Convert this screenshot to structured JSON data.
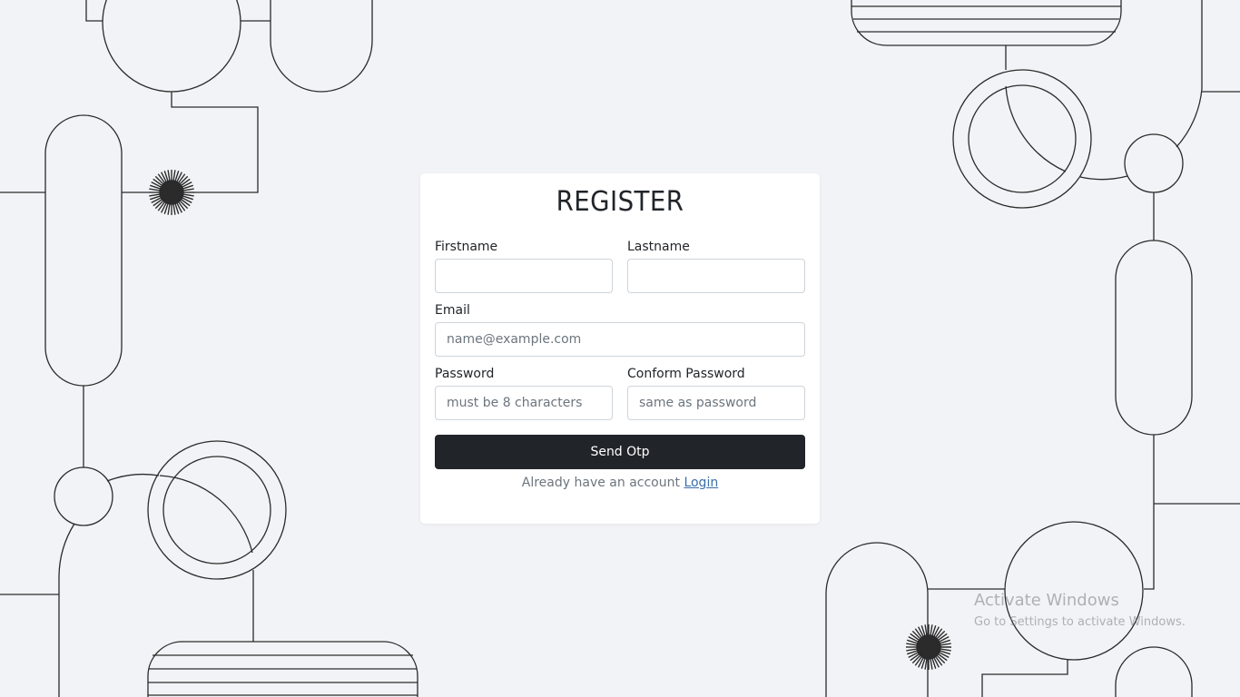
{
  "form": {
    "title": "REGISTER",
    "firstname_label": "Firstname",
    "firstname_value": "",
    "lastname_label": "Lastname",
    "lastname_value": "",
    "email_label": "Email",
    "email_placeholder": "name@example.com",
    "password_label": "Password",
    "password_placeholder": "must be 8 characters",
    "confirm_label": "Conform Password",
    "confirm_placeholder": "same as password",
    "submit_label": "Send Otp",
    "footer_text": "Already have an account ",
    "login_link": "Login"
  },
  "watermark": {
    "line1": "Activate Windows",
    "line2": "Go to Settings to activate Windows."
  },
  "colors": {
    "background": "#f2f3f6",
    "card": "#ffffff",
    "button": "#212529",
    "line": "#2b2b2b"
  }
}
